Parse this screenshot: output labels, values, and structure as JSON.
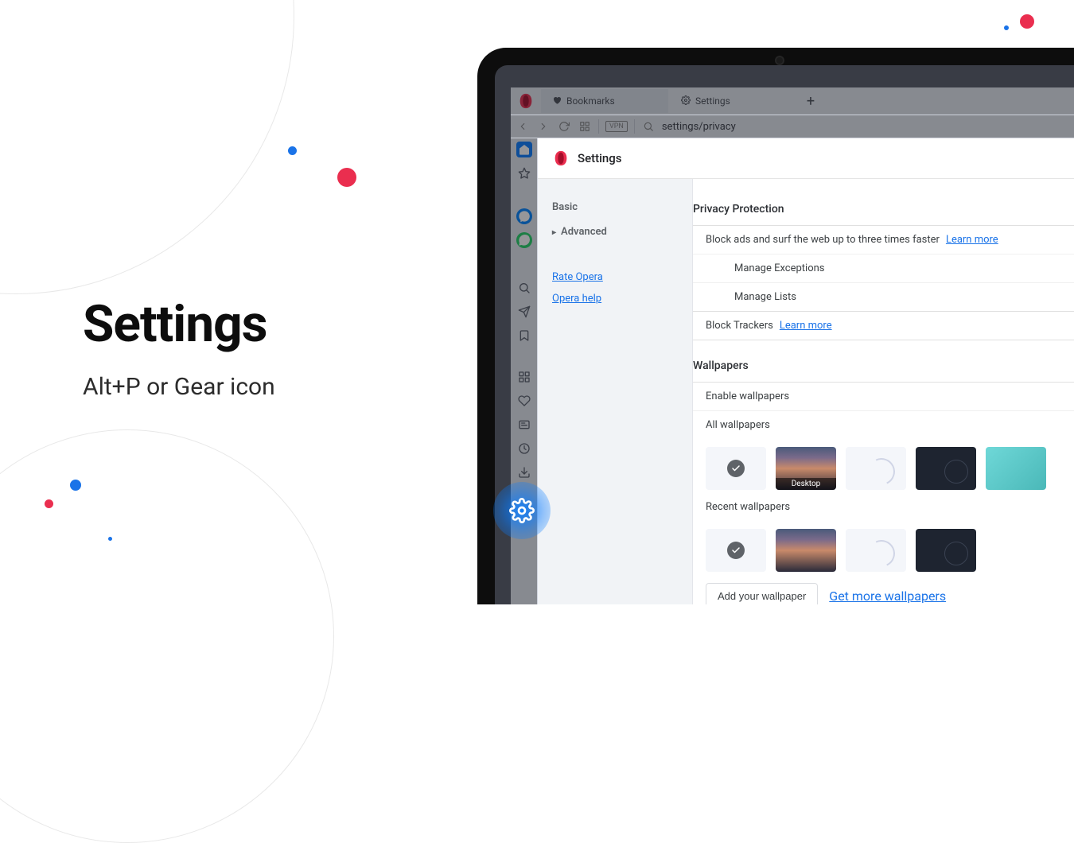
{
  "promo": {
    "title": "Settings",
    "subtitle": "Alt+P or Gear icon"
  },
  "tabs": {
    "bookmarks": "Bookmarks",
    "settings": "Settings"
  },
  "address_bar": {
    "vpn": "VPN",
    "url": "settings/privacy"
  },
  "settings_header": {
    "title": "Settings"
  },
  "settings_nav": {
    "basic": "Basic",
    "advanced": "Advanced",
    "rate": "Rate Opera",
    "help": "Opera help"
  },
  "privacy": {
    "title": "Privacy Protection",
    "block_ads": "Block ads and surf the web up to three times faster",
    "learn_more": "Learn more",
    "manage_exceptions": "Manage Exceptions",
    "manage_lists": "Manage Lists",
    "block_trackers": "Block Trackers"
  },
  "wallpapers": {
    "title": "Wallpapers",
    "enable": "Enable wallpapers",
    "all": "All wallpapers",
    "recent": "Recent wallpapers",
    "desktop": "Desktop",
    "add": "Add your wallpaper",
    "get_more": "Get more wallpapers"
  }
}
